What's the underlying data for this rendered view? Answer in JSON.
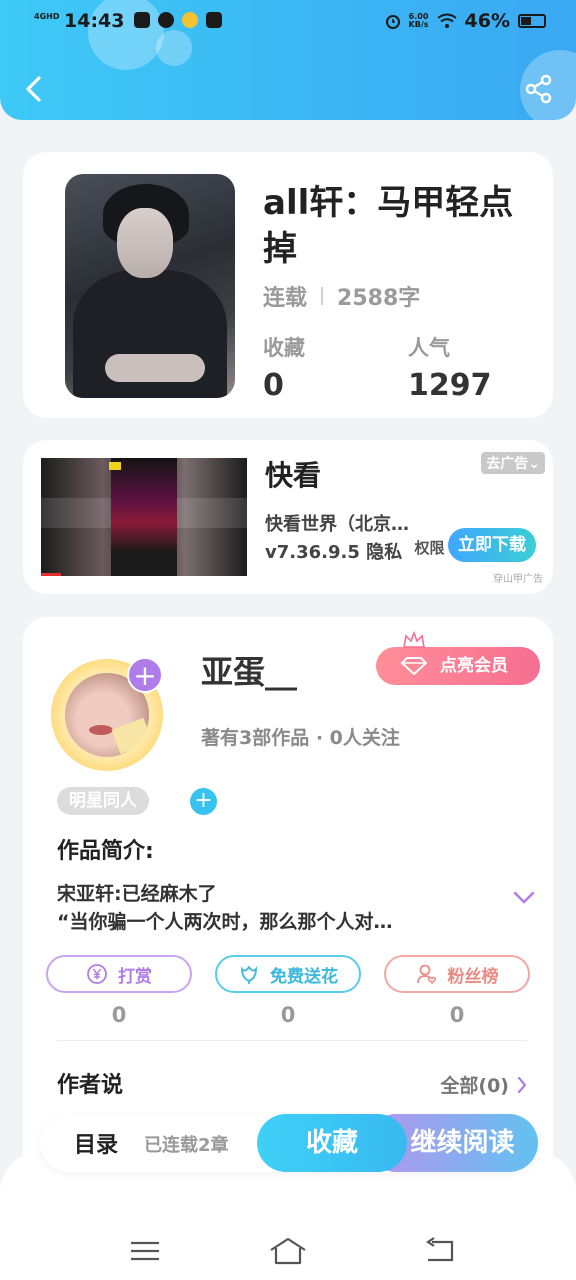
{
  "status_bar": {
    "network": "4GHD",
    "time": "14:43",
    "speed_value": "6.00",
    "speed_unit": "KB/s",
    "battery": "46%"
  },
  "header": {
    "back_icon": "chevron-left-icon",
    "share_icon": "share-icon"
  },
  "book": {
    "title": "all轩：马甲轻点掉",
    "status": "连载",
    "word_count": "2588字",
    "favorites_label": "收藏",
    "favorites_value": "0",
    "popularity_label": "人气",
    "popularity_value": "1297"
  },
  "ad": {
    "title": "快看",
    "line1": "快看世界（北京…",
    "version": "v7.36.9.5",
    "privacy": "隐私",
    "extra": "权限",
    "remove_ad": "去广告",
    "download_button": "立即下载",
    "source": "穿山甲广告"
  },
  "author": {
    "name": "亚蛋__",
    "vip_button": "点亮会员",
    "meta": "著有3部作品 · 0人关注",
    "tag": "明星同人"
  },
  "intro": {
    "heading": "作品简介:",
    "line1": "宋亚轩:已经麻木了",
    "line2": "“当你骗一个人两次时，那么那个人对…"
  },
  "actions": [
    {
      "label": "打赏",
      "count": "0",
      "icon": "yen-coin-icon"
    },
    {
      "label": "免费送花",
      "count": "0",
      "icon": "flower-icon"
    },
    {
      "label": "粉丝榜",
      "count": "0",
      "icon": "fan-ranking-icon"
    }
  ],
  "author_says": {
    "heading": "作者说",
    "all_label": "全部(0)"
  },
  "bottom_bar": {
    "toc_label": "目录",
    "chapters_label": "已连载2章",
    "favorite_button": "收藏",
    "continue_button": "继续阅读"
  },
  "colors": {
    "header_gradient_start": "#3ec9f6",
    "header_gradient_end": "#3aa8f2",
    "vip_pink": "#f66f91",
    "purple": "#b07ce9",
    "cyan": "#37c3f0",
    "salmon": "#ec8a84"
  }
}
